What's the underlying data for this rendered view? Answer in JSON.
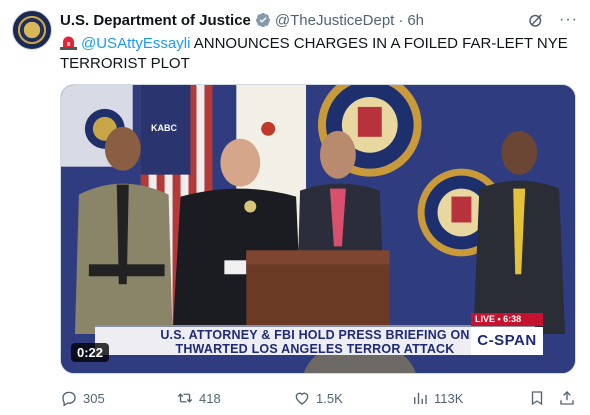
{
  "post": {
    "author_name": "U.S. Department of Justice",
    "handle": "@TheJusticeDept",
    "separator": "·",
    "time": "6h",
    "more_label": "···",
    "text_mention": "@USAttyEssayli",
    "text_body": " ANNOUNCES CHARGES IN A FOILED FAR-LEFT NYE TERRORIST PLOT"
  },
  "media": {
    "station_bug": "KABC",
    "chyron_line1": "U.S. ATTORNEY & FBI HOLD PRESS BRIEFING ON",
    "chyron_line2": "THWARTED LOS ANGELES TERROR ATTACK",
    "live_label": "LIVE • 6:38",
    "network_logo": "C-SPAN",
    "duration": "0:22"
  },
  "actions": {
    "replies": "305",
    "reposts": "418",
    "likes": "1.5K",
    "views": "113K"
  },
  "colors": {
    "link": "#1d9bf0",
    "muted_text": "#536471",
    "verified_badge": "#829aab",
    "chyron_text": "#1e2a78",
    "live_red": "#c4122f"
  },
  "icons": [
    "doj-seal-avatar",
    "verified-badge-icon",
    "grok-icon",
    "more-icon",
    "siren-icon",
    "reply-icon",
    "repost-icon",
    "like-icon",
    "views-icon",
    "bookmark-icon",
    "share-icon"
  ]
}
